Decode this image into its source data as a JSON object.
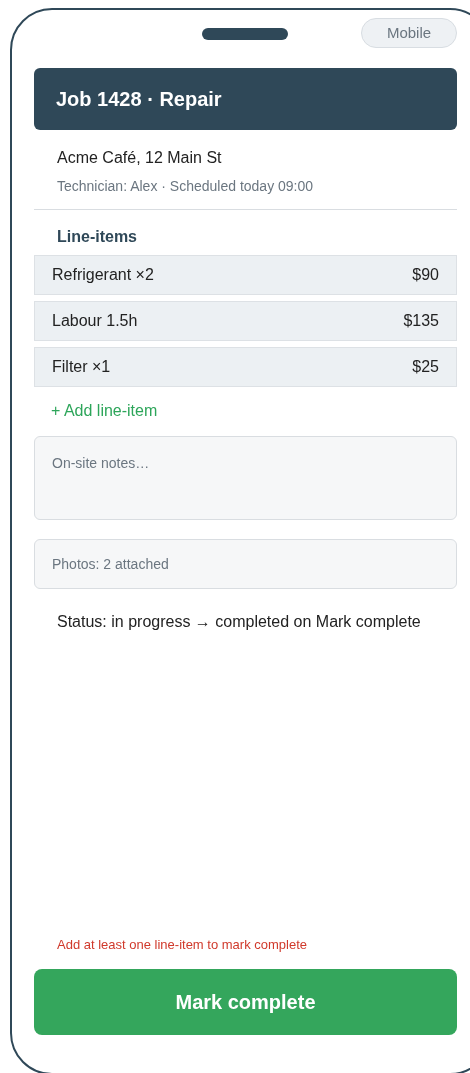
{
  "device_badge": "Mobile",
  "header": {
    "title": "Job 1428 · Repair"
  },
  "job": {
    "address": "Acme Café, 12 Main St",
    "meta": "Technician: Alex · Scheduled today 09:00"
  },
  "line_items": {
    "heading": "Line-items",
    "items": [
      {
        "name": "Refrigerant ×2",
        "price": "$90"
      },
      {
        "name": "Labour 1.5h",
        "price": "$135"
      },
      {
        "name": "Filter ×1",
        "price": "$25"
      }
    ],
    "add_link": "+ Add line-item"
  },
  "notes": {
    "placeholder": "On-site notes…"
  },
  "photos": {
    "label": "Photos: 2 attached"
  },
  "status_note": "Status: in progress → completed on Mark complete",
  "error": "Add at least one line-item to mark complete",
  "primary_button": {
    "label": "Mark complete"
  }
}
